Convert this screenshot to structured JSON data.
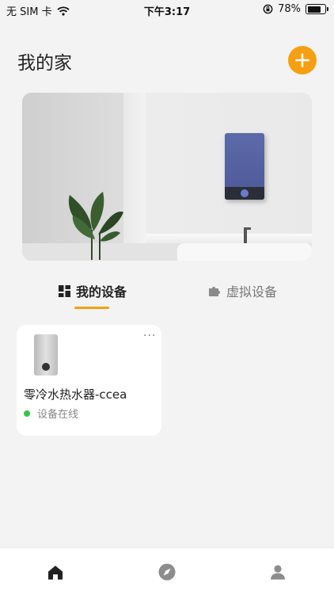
{
  "status_bar": {
    "carrier": "无 SIM 卡",
    "time": "下午3:17",
    "battery": "78%",
    "battery_level": 0.78
  },
  "header": {
    "title": "我的家",
    "add_icon": "plus-icon"
  },
  "tabs": [
    {
      "label": "我的设备",
      "icon": "grid-icon",
      "active": true
    },
    {
      "label": "虚拟设备",
      "icon": "puzzle-icon",
      "active": false
    }
  ],
  "devices": [
    {
      "name": "零冷水热水器-ccea",
      "status": "设备在线",
      "more": "···"
    }
  ],
  "bottom_nav": [
    {
      "icon": "home-icon",
      "active": true
    },
    {
      "icon": "compass-icon",
      "active": false
    },
    {
      "icon": "user-icon",
      "active": false
    }
  ],
  "colors": {
    "accent": "#f5a012",
    "online": "#36c44b",
    "background": "#f3f3f3"
  }
}
